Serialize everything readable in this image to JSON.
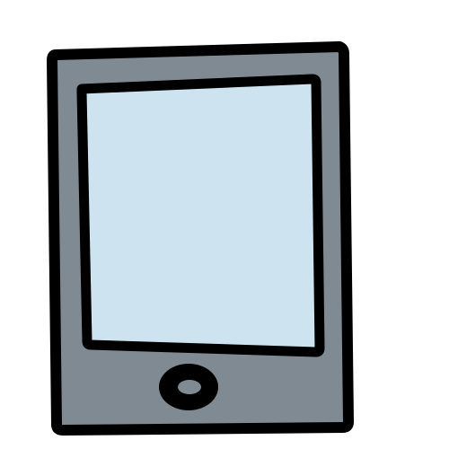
{
  "illustration": {
    "subject": "tablet-icon",
    "colors": {
      "background": "#ffffff",
      "outline": "#000000",
      "body": "#7f8a92",
      "screen": "#cde4f0",
      "button": "#000000",
      "button_highlight": "#7f8a92"
    },
    "parts": [
      {
        "name": "tablet-body",
        "icon": "tablet-icon"
      },
      {
        "name": "tablet-screen",
        "icon": "screen-icon"
      },
      {
        "name": "home-button",
        "icon": "circle-button-icon"
      }
    ]
  }
}
